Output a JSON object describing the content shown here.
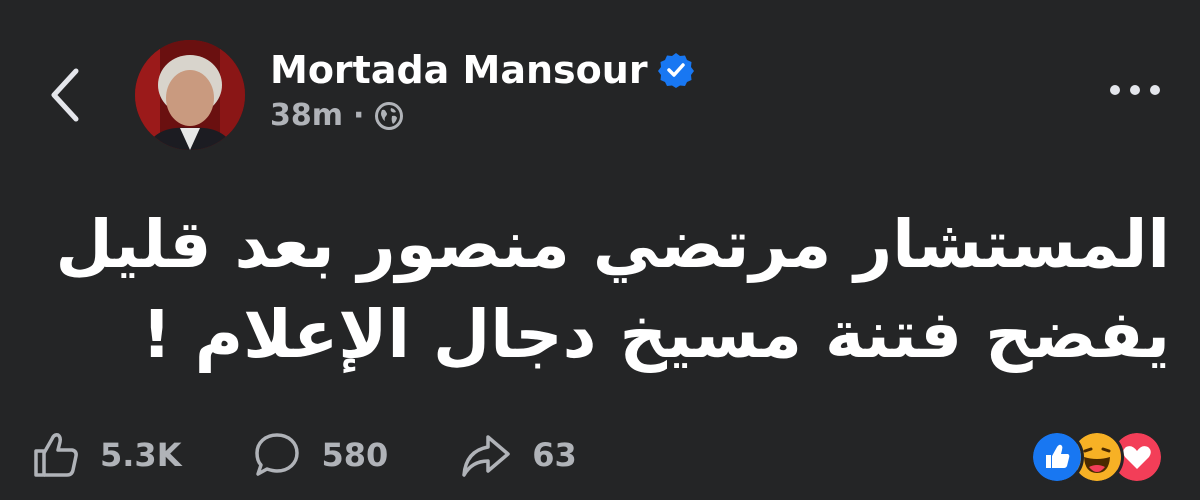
{
  "post": {
    "author_name": "Mortada Mansour",
    "verified": true,
    "time": "38m",
    "separator": "·",
    "audience_icon": "globe-icon",
    "text_lines": [
      "المستشار مرتضي منصور بعد قليل",
      "يفضح فتنة مسيخ دجال الإعلام !"
    ]
  },
  "actions": {
    "likes": "5.3K",
    "comments": "580",
    "shares": "63"
  },
  "reactions": [
    "like-reaction-icon",
    "haha-reaction-icon",
    "love-reaction-icon"
  ],
  "colors": {
    "background": "#242526",
    "verified_blue": "#1877f2",
    "love_red": "#f33e58",
    "haha_yellow": "#f7b125"
  }
}
